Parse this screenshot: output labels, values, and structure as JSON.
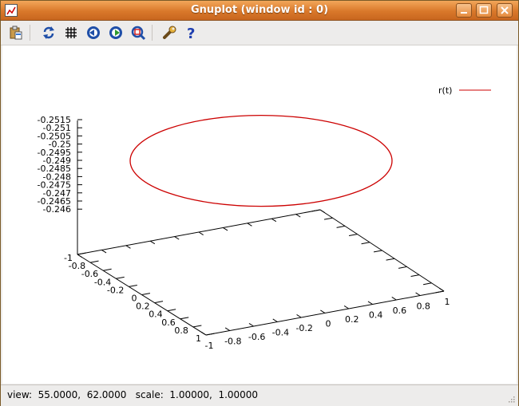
{
  "window": {
    "title": "Gnuplot (window id : 0)"
  },
  "toolbar": {
    "items": [
      {
        "name": "copy-clipboard",
        "icon": "clipboard-icon"
      },
      {
        "name": "replot",
        "icon": "refresh-icon"
      },
      {
        "name": "grid",
        "icon": "grid-icon"
      },
      {
        "name": "zoom-previous",
        "icon": "zoom-previous-icon"
      },
      {
        "name": "zoom-next",
        "icon": "zoom-next-icon"
      },
      {
        "name": "autoscale",
        "icon": "autoscale-icon"
      },
      {
        "name": "options",
        "icon": "wrench-icon"
      },
      {
        "name": "help",
        "icon": "help-icon"
      }
    ]
  },
  "status": {
    "text": "view:  55.0000,  62.0000   scale:  1.00000,  1.00000"
  },
  "colors": {
    "curve": "#cc0000",
    "titlebar": "#d9782a"
  },
  "chart_data": {
    "type": "line",
    "z_label_values": [
      "-0.2515",
      "-0.251",
      "-0.2505",
      "-0.25",
      "-0.2495",
      "-0.249",
      "-0.2485",
      "-0.248",
      "-0.2475",
      "-0.247",
      "-0.2465",
      "-0.246"
    ],
    "x_ticks": [
      "-1",
      "-0.8",
      "-0.6",
      "-0.4",
      "-0.2",
      "0",
      "0.2",
      "0.4",
      "0.6",
      "0.8",
      "1"
    ],
    "y_ticks": [
      "-1",
      "-0.8",
      "-0.6",
      "-0.4",
      "-0.2",
      "0",
      "0.2",
      "0.4",
      "0.6",
      "0.8",
      "1"
    ],
    "xlim": [
      -1,
      1
    ],
    "ylim": [
      -1,
      1
    ],
    "series": [
      {
        "name": "r(t)",
        "shape": "circle",
        "radius": 1,
        "z": -0.25
      }
    ],
    "legend": "top-right",
    "view": [
      55,
      62
    ]
  }
}
